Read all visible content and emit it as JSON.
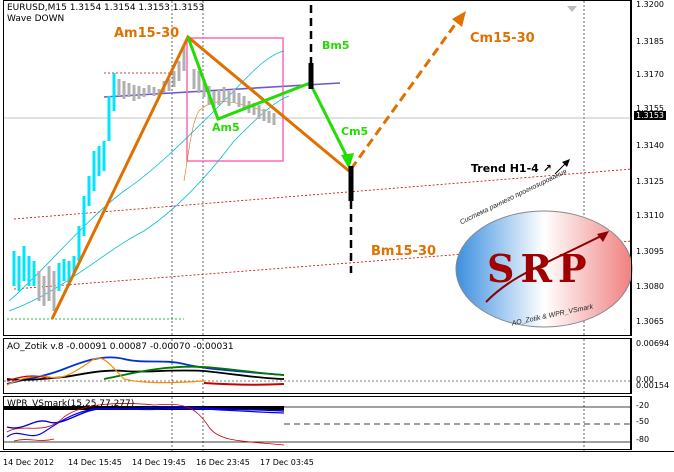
{
  "main": {
    "symbol_line": "EURUSD,M15  1.3154 1.3154 1.3153 1.3153",
    "wave_label": "Wave DOWN",
    "price_ticks": [
      "1.3200",
      "1.3185",
      "1.3170",
      "1.3155",
      "1.3140",
      "1.3125",
      "1.3110",
      "1.3095",
      "1.3080",
      "1.3065"
    ],
    "current_price": "1.3153",
    "annotations": {
      "am15_30": "Am15-30",
      "bm5": "Bm5",
      "am5": "Am5",
      "cm5": "Cm5",
      "cm15_30": "Cm15-30",
      "bm15_30": "Bm15-30",
      "trend": "Trend H1-4 ↗"
    },
    "logo": {
      "text": "SRP",
      "top_arc": "Система раннего прогнозирования",
      "bottom_arc": "AO_Zotik & WPR_VSmark"
    }
  },
  "ao_pane": {
    "label": "AO_Zotik v.8 -0.00091 0.00087 -0.00070 -0.00031",
    "ticks": [
      "0.00694",
      "0.00",
      "0.00154"
    ]
  },
  "wpr_pane": {
    "label": "WPR_VSmark(15,25,77,277)",
    "ticks": [
      "-20",
      "-50",
      "-80"
    ]
  },
  "time_axis": [
    "14 Dec 2012",
    "14 Dec 15:45",
    "14 Dec 19:45",
    "16 Dec 23:45",
    "17 Dec 03:45"
  ],
  "colors": {
    "orange": "#e07000",
    "green": "#22dd00",
    "cyan": "#00e5ff",
    "pink": "#ff69b4",
    "purple": "#6a5acd",
    "dark_red": "#cc0000"
  }
}
